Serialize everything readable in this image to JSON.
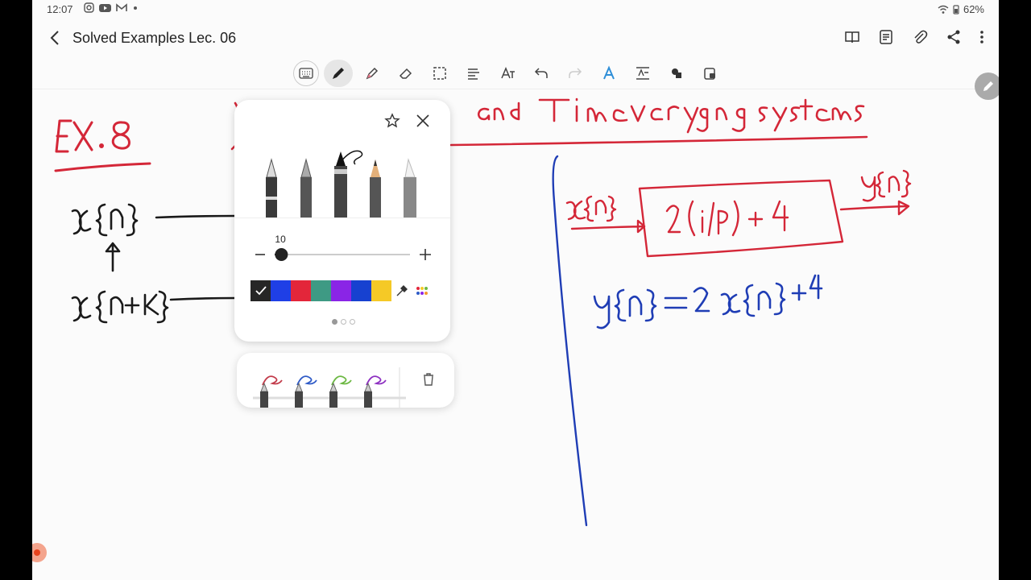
{
  "status_bar": {
    "time": "12:07",
    "notification_icons": [
      "instagram-icon",
      "youtube-icon",
      "gmail-icon",
      "more-dot-icon"
    ],
    "battery": "62%"
  },
  "app_bar": {
    "title": "Solved Examples Lec. 06",
    "actions": [
      "book-view-icon",
      "page-list-icon",
      "attach-icon",
      "share-icon",
      "more-vert-icon"
    ]
  },
  "toolbar": {
    "tools": [
      "keyboard-icon",
      "pen-icon",
      "highlighter-icon",
      "eraser-icon",
      "selection-icon",
      "text-align-icon",
      "handwriting-text-icon",
      "undo-icon",
      "redo-icon",
      "text-style-icon",
      "text-to-text-icon",
      "shapes-icon",
      "lock-icon"
    ],
    "active_tool": "pen-icon"
  },
  "pen_settings": {
    "pen_types": [
      "fountain-pen",
      "calligraphy-pen",
      "brush-pen",
      "pencil",
      "marker"
    ],
    "selected_pen": "brush-pen",
    "size_value": "10",
    "size": 0.05,
    "colors": [
      "#262626",
      "#1f3fe6",
      "#e3263a",
      "#3e9a84",
      "#8a25e6",
      "#1741d0",
      "#f5c926"
    ],
    "selected_color": "#262626",
    "page_count": 3,
    "current_page": 1
  },
  "pen_presets": {
    "colors": [
      "#c23b4a",
      "#2f5bc7",
      "#6cb843",
      "#8d2fc1"
    ]
  },
  "note": {
    "ink_colors": {
      "red": "#d42738",
      "blue": "#1f3db5",
      "black": "#1a1a1a"
    },
    "left_heading": "EX.8",
    "left_input_top": "x{n}",
    "left_input_bottom": "x{n+K}",
    "title_visible": "t and Time varying systems",
    "block_input": "x{n}",
    "block_content": "2(i/p) + 4",
    "block_output": "y{n}",
    "equation": "y{n} = 2 x{n} + 4"
  }
}
